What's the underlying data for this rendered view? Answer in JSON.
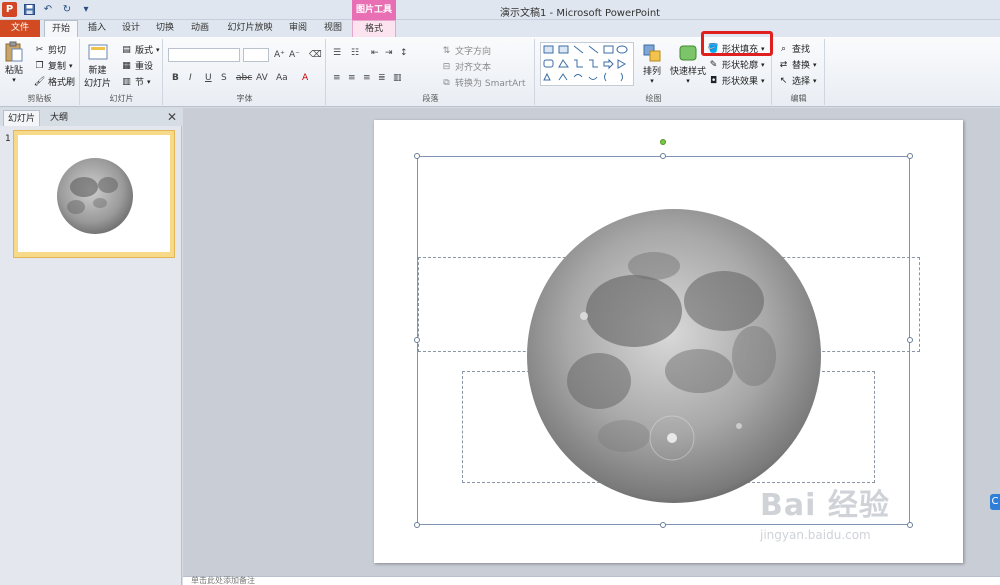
{
  "window": {
    "title": "演示文稿1 - Microsoft PowerPoint"
  },
  "context_tab": {
    "header": "图片工具",
    "tab": "格式"
  },
  "tabs": [
    {
      "label": "文件"
    },
    {
      "label": "开始"
    },
    {
      "label": "插入"
    },
    {
      "label": "设计"
    },
    {
      "label": "切换"
    },
    {
      "label": "动画"
    },
    {
      "label": "幻灯片放映"
    },
    {
      "label": "审阅"
    },
    {
      "label": "视图"
    }
  ],
  "clipboard": {
    "paste": "粘贴",
    "cut": "剪切",
    "copy": "复制",
    "format_painter": "格式刷",
    "group": "剪贴板"
  },
  "slides_group": {
    "new_slide": "新建",
    "new_slide_2": "幻灯片",
    "layout": "版式",
    "reset": "重设",
    "section": "节",
    "group": "幻灯片"
  },
  "font": {
    "group": "字体"
  },
  "paragraph": {
    "text_direction": "文字方向",
    "align_text": "对齐文本",
    "smartart": "转换为 SmartArt",
    "group": "段落"
  },
  "drawing": {
    "arrange": "排列",
    "quick_styles": "快速样式",
    "shape_fill": "形状填充",
    "shape_outline": "形状轮廓",
    "shape_effects": "形状效果",
    "group": "绘图"
  },
  "editing": {
    "find": "查找",
    "replace": "替换",
    "select": "选择",
    "group": "编辑"
  },
  "pane": {
    "tab_slides": "幻灯片",
    "tab_outline": "大纲",
    "close": "✕",
    "slide_number": "1"
  },
  "notes": {
    "placeholder": "单击此处添加备注"
  },
  "watermark": {
    "main": "Bai 经验",
    "sub": "jingyan.baidu.com"
  },
  "colors": {
    "file_tab": "#d14a22",
    "context": "#e86fb3",
    "highlight": "#e01f1f"
  }
}
